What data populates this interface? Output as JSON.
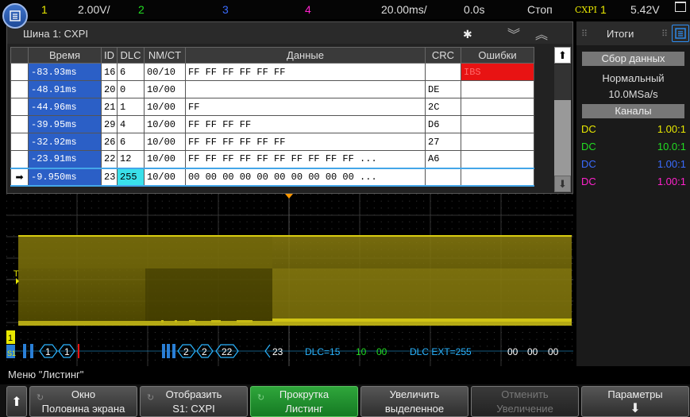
{
  "topbar": {
    "ch1": "1",
    "ch1_scale": "2.00V/",
    "ch2": "2",
    "ch3": "3",
    "ch4": "4",
    "timebase": "20.00ms/",
    "delay": "0.0s",
    "status": "Стоп",
    "trigger_label": "CXPI",
    "trigger_ch": "1",
    "trigger_level": "5.42V"
  },
  "listing": {
    "title": "Шина 1: CXPI",
    "columns": [
      "Время",
      "ID",
      "DLC",
      "NM/CT",
      "Данные",
      "CRC",
      "Ошибки"
    ],
    "rows": [
      {
        "time": "-83.93ms",
        "id": "16",
        "dlc": "6",
        "nmct": "00/10",
        "data": "FF FF FF FF FF FF",
        "crc": "",
        "err": "IBS"
      },
      {
        "time": "-48.91ms",
        "id": "20",
        "dlc": "0",
        "nmct": "10/00",
        "data": "",
        "crc": "DE",
        "err": ""
      },
      {
        "time": "-44.96ms",
        "id": "21",
        "dlc": "1",
        "nmct": "10/00",
        "data": "FF",
        "crc": "2C",
        "err": ""
      },
      {
        "time": "-39.95ms",
        "id": "29",
        "dlc": "4",
        "nmct": "10/00",
        "data": "FF FF FF FF",
        "crc": "D6",
        "err": ""
      },
      {
        "time": "-32.92ms",
        "id": "26",
        "dlc": "6",
        "nmct": "10/00",
        "data": "FF FF FF FF FF FF",
        "crc": "27",
        "err": ""
      },
      {
        "time": "-23.91ms",
        "id": "22",
        "dlc": "12",
        "nmct": "10/00",
        "data": "FF FF FF FF FF FF FF FF FF FF ...",
        "crc": "A6",
        "err": ""
      },
      {
        "time": "-9.950ms",
        "id": "23",
        "dlc": "255",
        "nmct": "10/00",
        "data": "00 00 00 00 00 00 00 00 00 00 ...",
        "crc": "",
        "err": ""
      }
    ]
  },
  "right_panel": {
    "title": "Итоги",
    "acq_header": "Сбор данных",
    "acq_mode": "Нормальный",
    "sample_rate": "10.0MSa/s",
    "channels_header": "Каналы",
    "channels": [
      {
        "coupling": "DC",
        "probe": "1.00:1",
        "color": "#e8e800"
      },
      {
        "coupling": "DC",
        "probe": "10.0:1",
        "color": "#22dd22"
      },
      {
        "coupling": "DC",
        "probe": "1.00:1",
        "color": "#3a6cff"
      },
      {
        "coupling": "DC",
        "probe": "1.00:1",
        "color": "#ff22cc"
      }
    ]
  },
  "decode": {
    "bus_label": "S1",
    "frame_a": "1",
    "frame_b": "1",
    "frame_c": "2",
    "frame_d": "2",
    "frame_e": "22",
    "frame_f": "23",
    "dlc_text": "DLC=15",
    "val1": "10",
    "val2": "00",
    "dlc_ext": "DLC EXT=255",
    "tail1": "00",
    "tail2": "00",
    "tail3": "00"
  },
  "menu_label": "Меню \"Листинг\"",
  "softkeys": [
    {
      "line1": "Окно",
      "line2": "Половина экрана"
    },
    {
      "line1": "Отобразить",
      "line2": "S1: CXPI"
    },
    {
      "line1": "Прокрутка",
      "line2": "Листинг"
    },
    {
      "line1": "Увеличить",
      "line2": "выделенное"
    },
    {
      "line1": "Отменить",
      "line2": "Увеличение"
    },
    {
      "line1": "Параметры",
      "line2": ""
    }
  ],
  "colors": {
    "ch1": "#e8e800",
    "ch2": "#22dd22",
    "ch3": "#3a6cff",
    "ch4": "#ff22cc",
    "decode": "#2ab4ff"
  }
}
